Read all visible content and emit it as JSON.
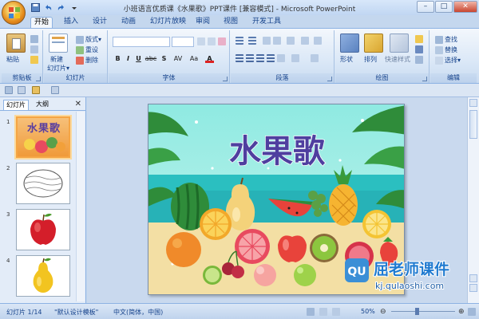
{
  "window": {
    "title": "小班语言优质课《水果歌》PPT课件 [兼容模式] - Microsoft PowerPoint",
    "min_label": "–",
    "max_label": "□",
    "close_label": "✕"
  },
  "tabs": [
    {
      "label": "开始"
    },
    {
      "label": "插入"
    },
    {
      "label": "设计"
    },
    {
      "label": "动画"
    },
    {
      "label": "幻灯片放映"
    },
    {
      "label": "审阅"
    },
    {
      "label": "视图"
    },
    {
      "label": "开发工具"
    }
  ],
  "ribbon": {
    "clipboard": {
      "group": "剪贴板",
      "paste": "粘贴"
    },
    "slides": {
      "group": "幻灯片",
      "new_slide_1": "新建",
      "new_slide_2": "幻灯片▾",
      "layout": "版式▾",
      "reset": "重设",
      "delete": "删除"
    },
    "font": {
      "group": "字体",
      "bold": "B",
      "italic": "I",
      "underline": "U",
      "strike": "abc",
      "shadow": "S",
      "spacing": "AV",
      "case": "Aa",
      "color": "A"
    },
    "paragraph": {
      "group": "段落"
    },
    "drawing": {
      "group": "绘图",
      "shapes": "形状",
      "arrange": "排列",
      "quick_styles": "快速样式"
    },
    "editing": {
      "group": "编辑",
      "find": "查找",
      "replace": "替换",
      "select": "选择▾"
    }
  },
  "panel": {
    "tab_slides": "幻灯片",
    "tab_outline": "大纲",
    "close": "✕",
    "thumbs": [
      {
        "num": "1",
        "title": "水果歌"
      },
      {
        "num": "2"
      },
      {
        "num": "3"
      },
      {
        "num": "4"
      }
    ]
  },
  "slide": {
    "title": "水果歌",
    "colors": {
      "sky": "#7fe6df",
      "sea": "#2bbfc0",
      "sand": "#f3dfa4",
      "title": "#4f3f9f"
    }
  },
  "watermark": {
    "brand": "屈老师课件",
    "url": "kj.qulaoshi.com",
    "logo": "QU"
  },
  "status": {
    "slide_info": "幻灯片 1/14",
    "theme": "\"默认设计模板\"",
    "language": "中文(简体，中国)",
    "zoom": "50%"
  }
}
